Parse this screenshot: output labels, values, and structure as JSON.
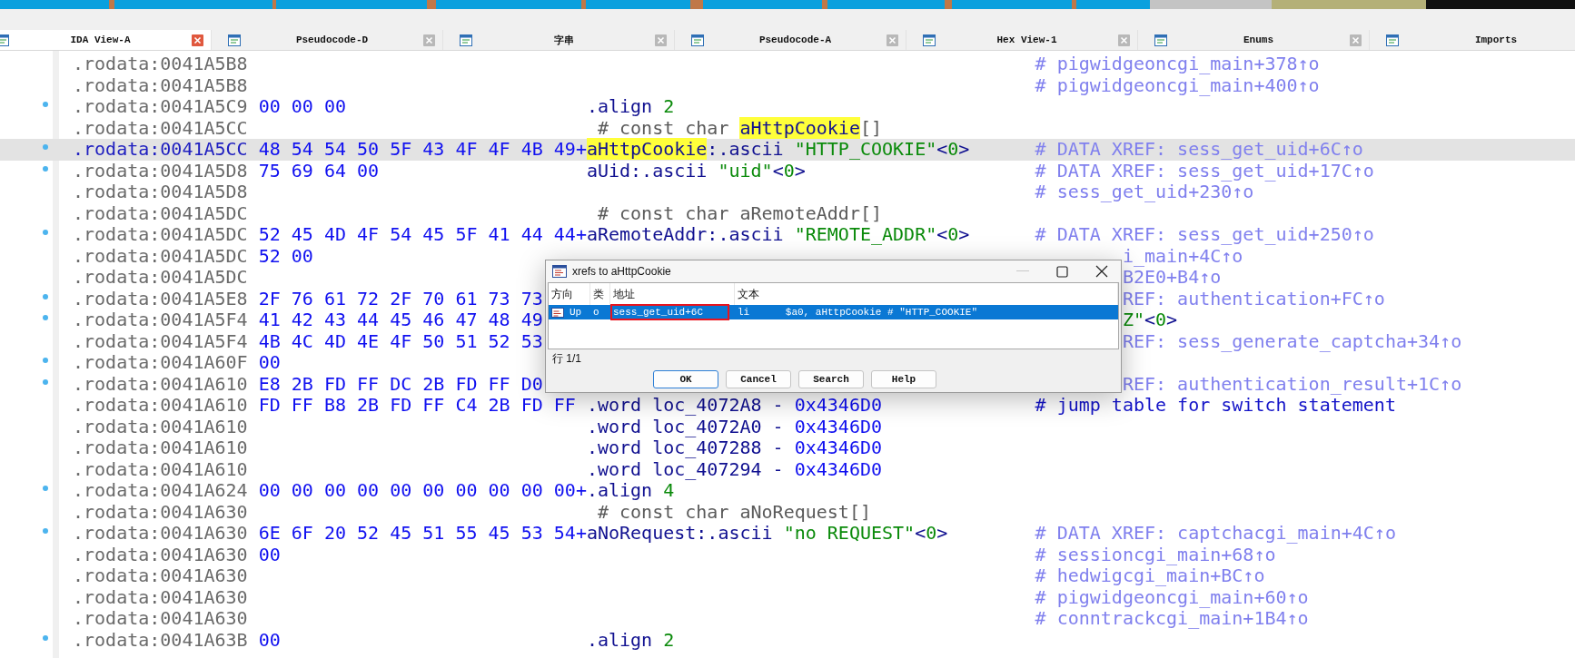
{
  "tabs": [
    {
      "label": "IDA View-A",
      "selected": true,
      "closable": true
    },
    {
      "label": "Pseudocode-D",
      "selected": false,
      "closable": true
    },
    {
      "label": "字串",
      "selected": false,
      "closable": true
    },
    {
      "label": "Pseudocode-A",
      "selected": false,
      "closable": true
    },
    {
      "label": "Hex View-1",
      "selected": false,
      "closable": true
    },
    {
      "label": "Enums",
      "selected": false,
      "closable": true
    },
    {
      "label": "Imports",
      "selected": false,
      "closable": false
    }
  ],
  "listing": {
    "lines": [
      {
        "marked": false,
        "selected": false,
        "address": ".rodata:0041A5B8",
        "comment": {
          "text": "# pigwidgeoncgi_main+378↑o",
          "kind": "xref"
        }
      },
      {
        "marked": false,
        "selected": false,
        "address": ".rodata:0041A5B8",
        "comment": {
          "text": "# pigwidgeoncgi_main+400↑o",
          "kind": "xref"
        }
      },
      {
        "marked": true,
        "selected": false,
        "address": ".rodata:0041A5C9",
        "bytes": "00 00 00",
        "code": [
          {
            "text": ".align ",
            "kind": "code"
          },
          {
            "text": "2",
            "kind": "num"
          }
        ]
      },
      {
        "marked": false,
        "selected": false,
        "address": ".rodata:0041A5CC",
        "code": [
          {
            "text": "# const char ",
            "kind": "note"
          },
          {
            "text": "aHttpCookie",
            "kind": "hl"
          },
          {
            "text": "[]",
            "kind": "note"
          }
        ]
      },
      {
        "marked": true,
        "selected": true,
        "address": ".rodata:0041A5CC",
        "bytes": "48 54 54 50 5F 43 4F 4F 4B 49+",
        "code": [
          {
            "text": "aHttpCookie",
            "kind": "hl"
          },
          {
            "text": ":.ascii ",
            "kind": "code"
          },
          {
            "text": "\"HTTP_COOKIE\"",
            "kind": "str"
          },
          {
            "text": "<",
            "kind": "code"
          },
          {
            "text": "0",
            "kind": "num"
          },
          {
            "text": ">",
            "kind": "code"
          }
        ],
        "comment": {
          "text": "# DATA XREF: sess_get_uid+6C↑o",
          "kind": "xref"
        }
      },
      {
        "marked": true,
        "selected": false,
        "address": ".rodata:0041A5D8",
        "bytes": "75 69 64 00",
        "code": [
          {
            "text": "aUid:.ascii ",
            "kind": "code"
          },
          {
            "text": "\"uid\"",
            "kind": "str"
          },
          {
            "text": "<",
            "kind": "code"
          },
          {
            "text": "0",
            "kind": "num"
          },
          {
            "text": ">",
            "kind": "code"
          }
        ],
        "comment": {
          "text": "# DATA XREF: sess_get_uid+17C↑o",
          "kind": "xref"
        }
      },
      {
        "marked": false,
        "selected": false,
        "address": ".rodata:0041A5D8",
        "comment": {
          "text": "# sess_get_uid+230↑o",
          "kind": "xref"
        }
      },
      {
        "marked": false,
        "selected": false,
        "address": ".rodata:0041A5DC",
        "code": [
          {
            "text": "# const char aRemoteAddr[]",
            "kind": "note"
          }
        ]
      },
      {
        "marked": true,
        "selected": false,
        "address": ".rodata:0041A5DC",
        "bytes": "52 45 4D 4F 54 45 5F 41 44 44+",
        "code": [
          {
            "text": "aRemoteAddr:.ascii ",
            "kind": "code"
          },
          {
            "text": "\"REMOTE_ADDR\"",
            "kind": "str"
          },
          {
            "text": "<",
            "kind": "code"
          },
          {
            "text": "0",
            "kind": "num"
          },
          {
            "text": ">",
            "kind": "code"
          }
        ],
        "comment": {
          "text": "# DATA XREF: sess_get_uid+250↑o",
          "kind": "xref"
        }
      },
      {
        "marked": false,
        "selected": false,
        "address": ".rodata:0041A5DC",
        "bytes": "52 00",
        "tail": [
          {
            "text": "i_main+4C↑o",
            "kind": "xref"
          }
        ]
      },
      {
        "marked": false,
        "selected": false,
        "address": ".rodata:0041A5DC",
        "tail": [
          {
            "text": "B2E0+B4↑o",
            "kind": "xref"
          }
        ]
      },
      {
        "marked": true,
        "selected": false,
        "address": ".rodata:0041A5E8",
        "bytes": "2F 76 61 72 2F 70 61 73 73",
        "tail": [
          {
            "text": "REF: authentication+FC↑o",
            "kind": "xref"
          }
        ]
      },
      {
        "marked": true,
        "selected": false,
        "address": ".rodata:0041A5F4",
        "bytes": "41 42 43 44 45 46 47 48 49",
        "tail": [
          {
            "text": "Z\"",
            "kind": "str"
          },
          {
            "text": "<",
            "kind": "code"
          },
          {
            "text": "0",
            "kind": "num"
          },
          {
            "text": ">",
            "kind": "code"
          }
        ]
      },
      {
        "marked": false,
        "selected": false,
        "address": ".rodata:0041A5F4",
        "bytes": "4B 4C 4D 4E 4F 50 51 52 53",
        "tail": [
          {
            "text": "REF: sess_generate_captcha+34↑o",
            "kind": "xref"
          }
        ]
      },
      {
        "marked": true,
        "selected": false,
        "address": ".rodata:0041A60F",
        "bytes": "00"
      },
      {
        "marked": true,
        "selected": false,
        "address": ".rodata:0041A610",
        "bytes": "E8 2B FD FF DC 2B FD FF D0",
        "tail": [
          {
            "text": "REF: authentication_result+1C↑o",
            "kind": "xref"
          }
        ]
      },
      {
        "marked": false,
        "selected": false,
        "address": ".rodata:0041A610",
        "bytes": "FD FF B8 2B FD FF C4 2B FD FF",
        "code": [
          {
            "text": ".word loc_4072A8 - ",
            "kind": "code"
          },
          {
            "text": "0x4346D0",
            "kind": "hex"
          }
        ],
        "comment": {
          "text": "# jump table for switch statement",
          "kind": "auto"
        }
      },
      {
        "marked": false,
        "selected": false,
        "address": ".rodata:0041A610",
        "code": [
          {
            "text": ".word loc_4072A0 - ",
            "kind": "code"
          },
          {
            "text": "0x4346D0",
            "kind": "hex"
          }
        ]
      },
      {
        "marked": false,
        "selected": false,
        "address": ".rodata:0041A610",
        "code": [
          {
            "text": ".word loc_407288 - ",
            "kind": "code"
          },
          {
            "text": "0x4346D0",
            "kind": "hex"
          }
        ]
      },
      {
        "marked": false,
        "selected": false,
        "address": ".rodata:0041A610",
        "code": [
          {
            "text": ".word loc_407294 - ",
            "kind": "code"
          },
          {
            "text": "0x4346D0",
            "kind": "hex"
          }
        ]
      },
      {
        "marked": true,
        "selected": false,
        "address": ".rodata:0041A624",
        "bytes": "00 00 00 00 00 00 00 00 00 00+",
        "code": [
          {
            "text": ".align ",
            "kind": "code"
          },
          {
            "text": "4",
            "kind": "num"
          }
        ]
      },
      {
        "marked": false,
        "selected": false,
        "address": ".rodata:0041A630",
        "code": [
          {
            "text": "# const char aNoRequest[]",
            "kind": "note"
          }
        ]
      },
      {
        "marked": true,
        "selected": false,
        "address": ".rodata:0041A630",
        "bytes": "6E 6F 20 52 45 51 55 45 53 54+",
        "code": [
          {
            "text": "aNoRequest:.ascii ",
            "kind": "code"
          },
          {
            "text": "\"no REQUEST\"",
            "kind": "str"
          },
          {
            "text": "<",
            "kind": "code"
          },
          {
            "text": "0",
            "kind": "num"
          },
          {
            "text": ">",
            "kind": "code"
          }
        ],
        "comment": {
          "text": "# DATA XREF: captchacgi_main+4C↑o",
          "kind": "xref"
        }
      },
      {
        "marked": false,
        "selected": false,
        "address": ".rodata:0041A630",
        "bytes": "00",
        "comment": {
          "text": "# sessioncgi_main+68↑o",
          "kind": "xref"
        }
      },
      {
        "marked": false,
        "selected": false,
        "address": ".rodata:0041A630",
        "comment": {
          "text": "# hedwigcgi_main+BC↑o",
          "kind": "xref"
        }
      },
      {
        "marked": false,
        "selected": false,
        "address": ".rodata:0041A630",
        "comment": {
          "text": "# pigwidgeoncgi_main+60↑o",
          "kind": "xref"
        }
      },
      {
        "marked": false,
        "selected": false,
        "address": ".rodata:0041A630",
        "comment": {
          "text": "# conntrackcgi_main+1B4↑o",
          "kind": "xref"
        }
      },
      {
        "marked": true,
        "selected": false,
        "address": ".rodata:0041A63B",
        "bytes": "00",
        "code": [
          {
            "text": ".align ",
            "kind": "code"
          },
          {
            "text": "2",
            "kind": "num"
          }
        ]
      }
    ]
  },
  "dialog": {
    "title": "xrefs to aHttpCookie",
    "columns": [
      "方向",
      "类",
      "地址",
      "文本"
    ],
    "rows": [
      {
        "direction": "Up",
        "type": "o",
        "address": "sess_get_uid+6C",
        "text": "li      $a0, aHttpCookie # \"HTTP_COOKIE\"",
        "selected": true,
        "boxed": true
      }
    ],
    "status": "行 1/1",
    "buttons": [
      {
        "label": "OK",
        "default": true
      },
      {
        "label": "Cancel",
        "default": false
      },
      {
        "label": "Search",
        "default": false
      },
      {
        "label": "Help",
        "default": false
      }
    ]
  }
}
